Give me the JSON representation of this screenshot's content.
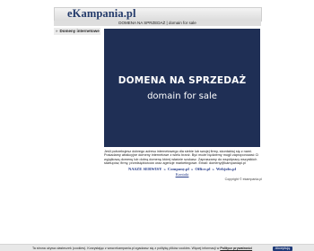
{
  "header": {
    "logo": "eKampania.pl",
    "breadcrumb": "DOMENA NA SPRZEDAŻ | domain for sale"
  },
  "sidebar": {
    "items": [
      {
        "arrow": "»",
        "label": "Domeny internetowe"
      }
    ]
  },
  "banner": {
    "title": "DOMENA NA SPRZEDAŻ",
    "subtitle": "domain for sale",
    "background_color": "#1f2f55"
  },
  "description": "Jeśli potrzebujesz dobrego adresu internetowego dla siebie lub swojej firmy, skontaktuj się z nami. Posiadamy atrakcyjne domeny internetowe z wielu branż. Być może będziemy mogli zaproponować Ci wyjątkową domenę lub dobrą domenę której właśnie szukasz. Zapraszamy do współpracy wszystkich startupów, firmy, przedsiębiorców oraz agencje marketingowe. Email: domeny@kampaniapl.pl",
  "footer": {
    "links": [
      {
        "label": "NASZE SERWISY"
      },
      {
        "label": "Company.pl"
      },
      {
        "label": "Office.pl"
      },
      {
        "label": "Webjobs.pl"
      }
    ],
    "separator": "»",
    "contact": "Kontakt",
    "copyright": "Copyright © ekampania.pl"
  },
  "cookie_bar": {
    "text": "Ta strona używa ciasteczek (cookies). Korzystając z www.ekampania.pl zgadzasz się z politykę plików cookies. Więcej informacji w",
    "policy_link": "Polityce prywatności",
    "accept_button": "Akceptuję"
  }
}
